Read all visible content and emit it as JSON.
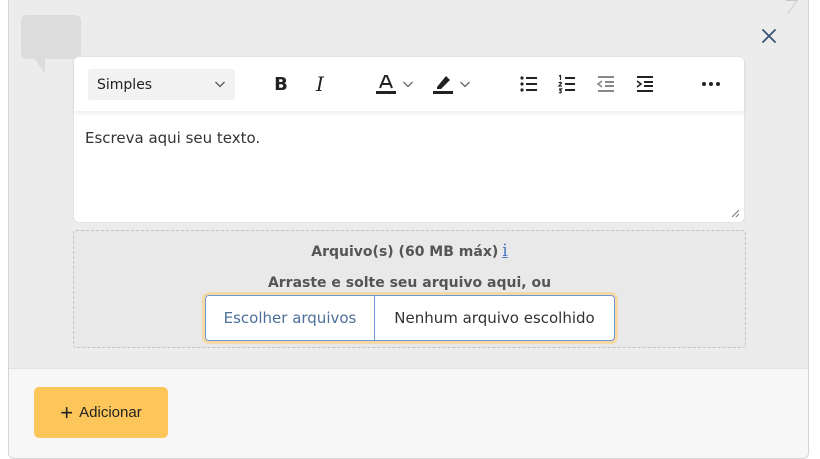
{
  "editor": {
    "style_select": "Simples",
    "content": "Escreva aqui seu texto.",
    "toolbar": {
      "bold_glyph": "B",
      "italic_glyph": "I"
    }
  },
  "upload": {
    "title": "Arquivo(s) (60 MB máx)",
    "info_glyph": "i",
    "hint": "Arraste e solte seu arquivo aqui, ou",
    "choose_label": "Escolher arquivos",
    "no_file_label": "Nenhum arquivo escolhido"
  },
  "footer": {
    "add_plus": "+",
    "add_label": "Adicionar"
  },
  "colors": {
    "accent_button": "#fcc65a",
    "picker_border": "#6e95d4",
    "focus_ring": "#f5d9a6",
    "info_link": "#4a78c2"
  }
}
